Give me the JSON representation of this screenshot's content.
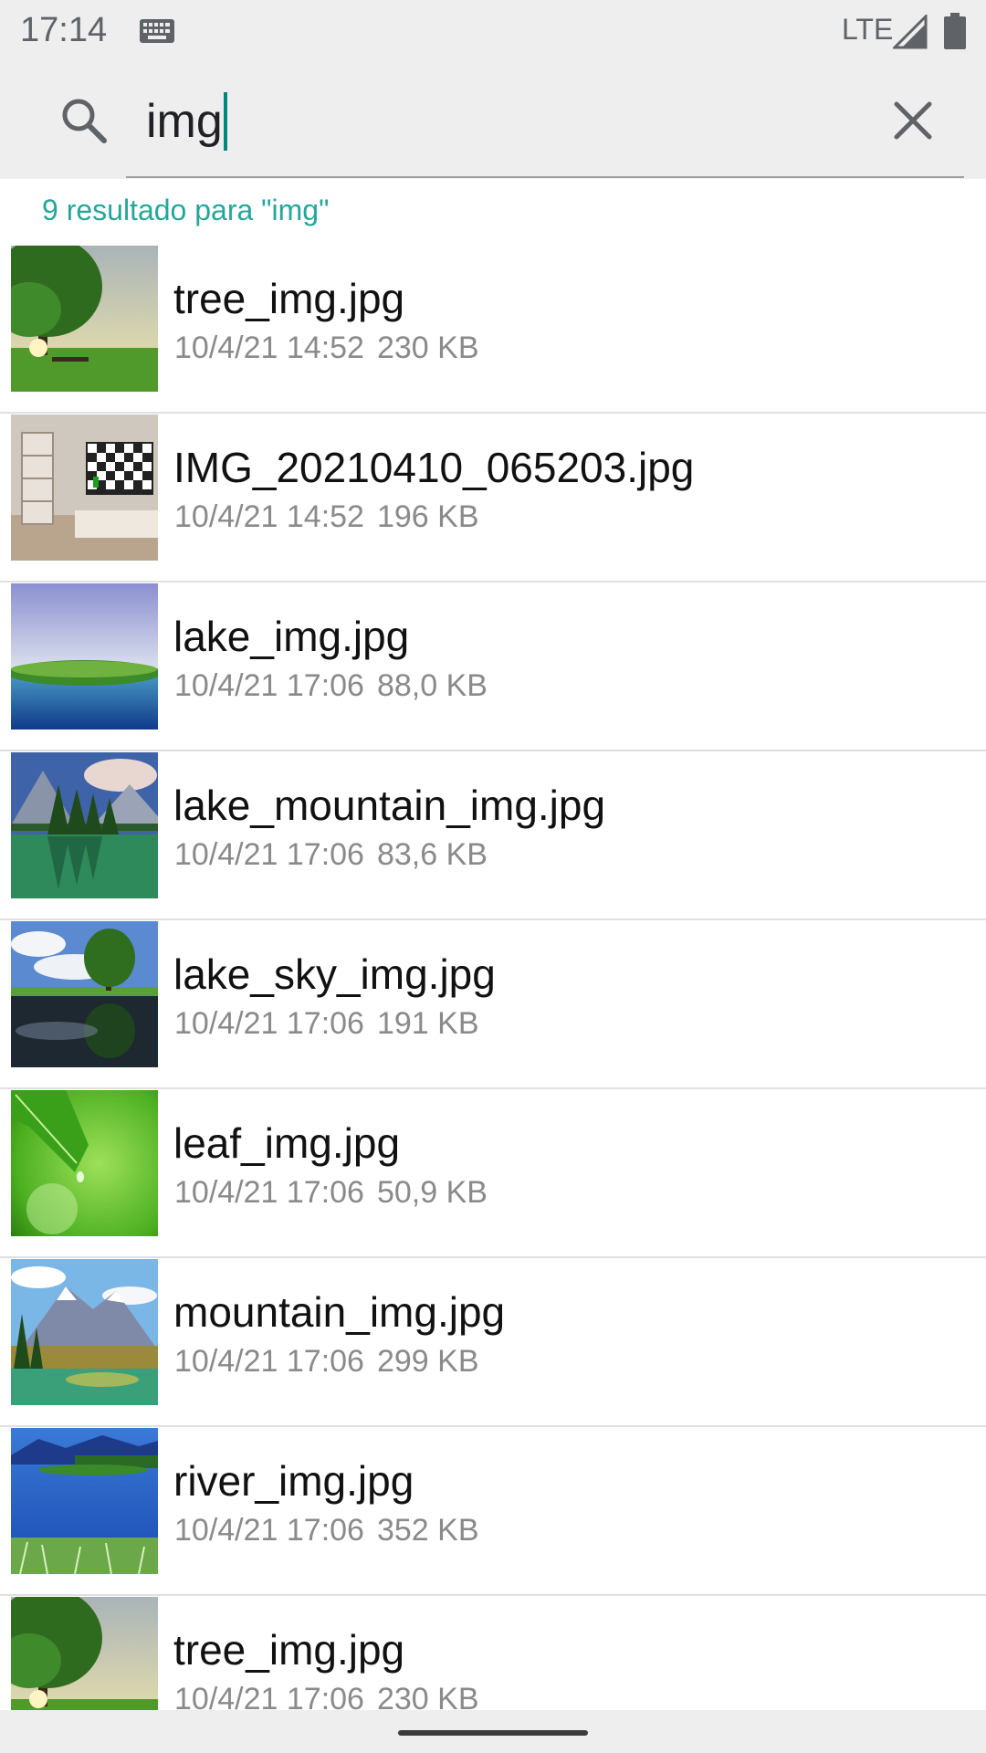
{
  "status_bar": {
    "time": "17:14",
    "network": "LTE",
    "icons": [
      "keyboard-icon",
      "signal-icon",
      "battery-icon"
    ]
  },
  "search": {
    "query": "img",
    "icons": [
      "search-icon",
      "close-icon"
    ]
  },
  "results": {
    "header": "9 resultado para \"img\"",
    "items": [
      {
        "name": "tree_img.jpg",
        "date": "10/4/21 14:52",
        "size": "230 KB",
        "thumb": "tree"
      },
      {
        "name": "IMG_20210410_065203.jpg",
        "date": "10/4/21 14:52",
        "size": "196 KB",
        "thumb": "room"
      },
      {
        "name": "lake_img.jpg",
        "date": "10/4/21 17:06",
        "size": "88,0 KB",
        "thumb": "lake"
      },
      {
        "name": "lake_mountain_img.jpg",
        "date": "10/4/21 17:06",
        "size": "83,6 KB",
        "thumb": "lake-mountain"
      },
      {
        "name": "lake_sky_img.jpg",
        "date": "10/4/21 17:06",
        "size": "191 KB",
        "thumb": "lake-sky"
      },
      {
        "name": "leaf_img.jpg",
        "date": "10/4/21 17:06",
        "size": "50,9 KB",
        "thumb": "leaf"
      },
      {
        "name": "mountain_img.jpg",
        "date": "10/4/21 17:06",
        "size": "299 KB",
        "thumb": "mountain"
      },
      {
        "name": "river_img.jpg",
        "date": "10/4/21 17:06",
        "size": "352 KB",
        "thumb": "river"
      },
      {
        "name": "tree_img.jpg",
        "date": "10/4/21 17:06",
        "size": "230 KB",
        "thumb": "tree"
      }
    ]
  },
  "colors": {
    "accent": "#26a69a",
    "cursor": "#00897b",
    "bar_background": "#eeeeee"
  }
}
